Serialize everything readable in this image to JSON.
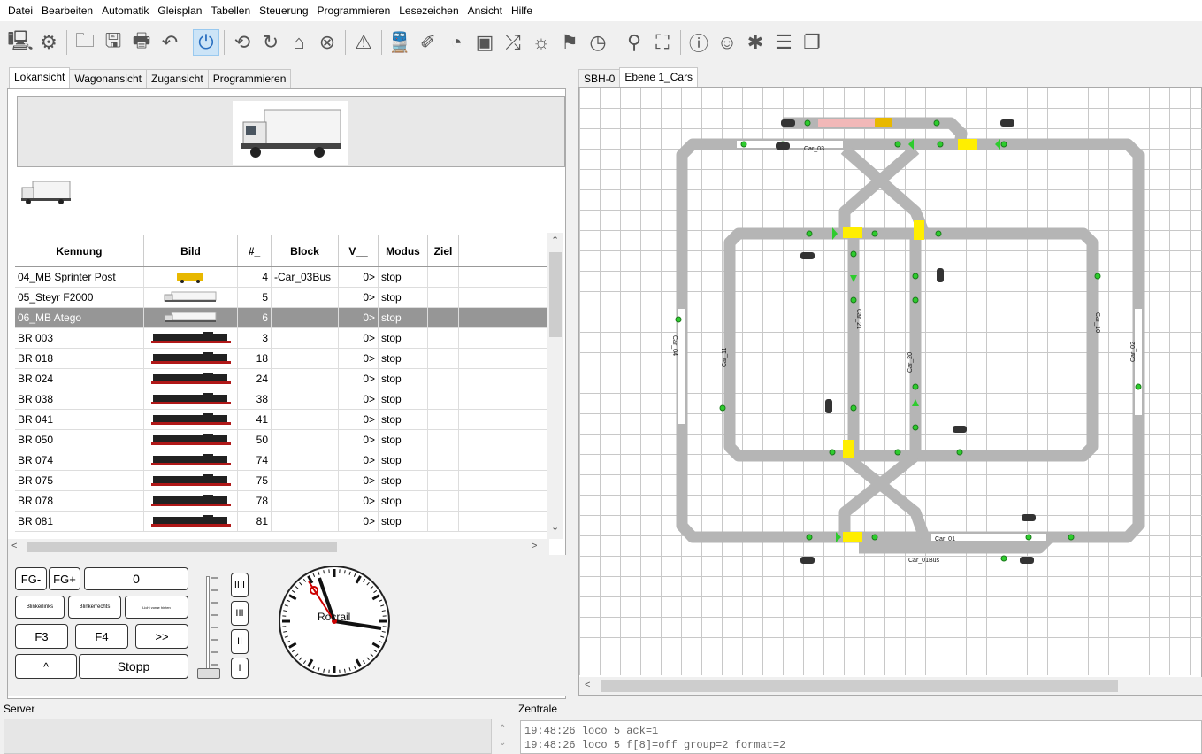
{
  "menu": [
    "Datei",
    "Bearbeiten",
    "Automatik",
    "Gleisplan",
    "Tabellen",
    "Steuerung",
    "Programmieren",
    "Lesezeichen",
    "Ansicht",
    "Hilfe"
  ],
  "left_tabs": [
    "Lokansicht",
    "Wagonansicht",
    "Zugansicht",
    "Programmieren"
  ],
  "right_tabs": [
    "SBH-0",
    "Ebene 1_Cars"
  ],
  "table": {
    "headers": [
      "Kennung",
      "Bild",
      "#_",
      "Block",
      "V__",
      "Modus",
      "Ziel"
    ],
    "rows": [
      {
        "id": "04_MB Sprinter Post",
        "num": "4",
        "block": "-Car_03Bus",
        "v": "0>",
        "mode": "stop",
        "img": "yellow"
      },
      {
        "id": "05_Steyr F2000",
        "num": "5",
        "block": "",
        "v": "0>",
        "mode": "stop",
        "img": "truck"
      },
      {
        "id": "06_MB Atego",
        "num": "6",
        "block": "",
        "v": "0>",
        "mode": "stop",
        "img": "truck"
      },
      {
        "id": "BR 003",
        "num": "3",
        "block": "",
        "v": "0>",
        "mode": "stop",
        "img": "loco"
      },
      {
        "id": "BR 018",
        "num": "18",
        "block": "",
        "v": "0>",
        "mode": "stop",
        "img": "loco"
      },
      {
        "id": "BR 024",
        "num": "24",
        "block": "",
        "v": "0>",
        "mode": "stop",
        "img": "loco"
      },
      {
        "id": "BR 038",
        "num": "38",
        "block": "",
        "v": "0>",
        "mode": "stop",
        "img": "loco"
      },
      {
        "id": "BR 041",
        "num": "41",
        "block": "",
        "v": "0>",
        "mode": "stop",
        "img": "loco"
      },
      {
        "id": "BR 050",
        "num": "50",
        "block": "",
        "v": "0>",
        "mode": "stop",
        "img": "loco"
      },
      {
        "id": "BR 074",
        "num": "74",
        "block": "",
        "v": "0>",
        "mode": "stop",
        "img": "loco"
      },
      {
        "id": "BR 075",
        "num": "75",
        "block": "",
        "v": "0>",
        "mode": "stop",
        "img": "loco"
      },
      {
        "id": "BR 078",
        "num": "78",
        "block": "",
        "v": "0>",
        "mode": "stop",
        "img": "loco"
      },
      {
        "id": "BR 081",
        "num": "81",
        "block": "",
        "v": "0>",
        "mode": "stop",
        "img": "loco"
      }
    ]
  },
  "controls": {
    "fg_minus": "FG-",
    "fg_plus": "FG+",
    "fg_value": "0",
    "blink_left": "Blinkerlinks",
    "blink_right": "Blinkerrechts",
    "light": "Licht vorne hinten",
    "f3": "F3",
    "f4": "F4",
    "more": ">>",
    "up": "^",
    "stop": "Stopp",
    "speed_steps": [
      "IIII",
      "III",
      "II",
      "I"
    ],
    "clock_brand": "Rocrail"
  },
  "plan_labels": [
    "Car_03",
    "Car_04",
    "Car_11",
    "Car_21",
    "Car_20",
    "Car_10",
    "Car_02",
    "Car_01",
    "Car_01Bus"
  ],
  "bottom": {
    "server": "Server",
    "central": "Zentrale",
    "log": [
      "19:48:26 loco 5 ack=1",
      "19:48:26 loco 5 f[8]=off group=2 format=2"
    ]
  }
}
